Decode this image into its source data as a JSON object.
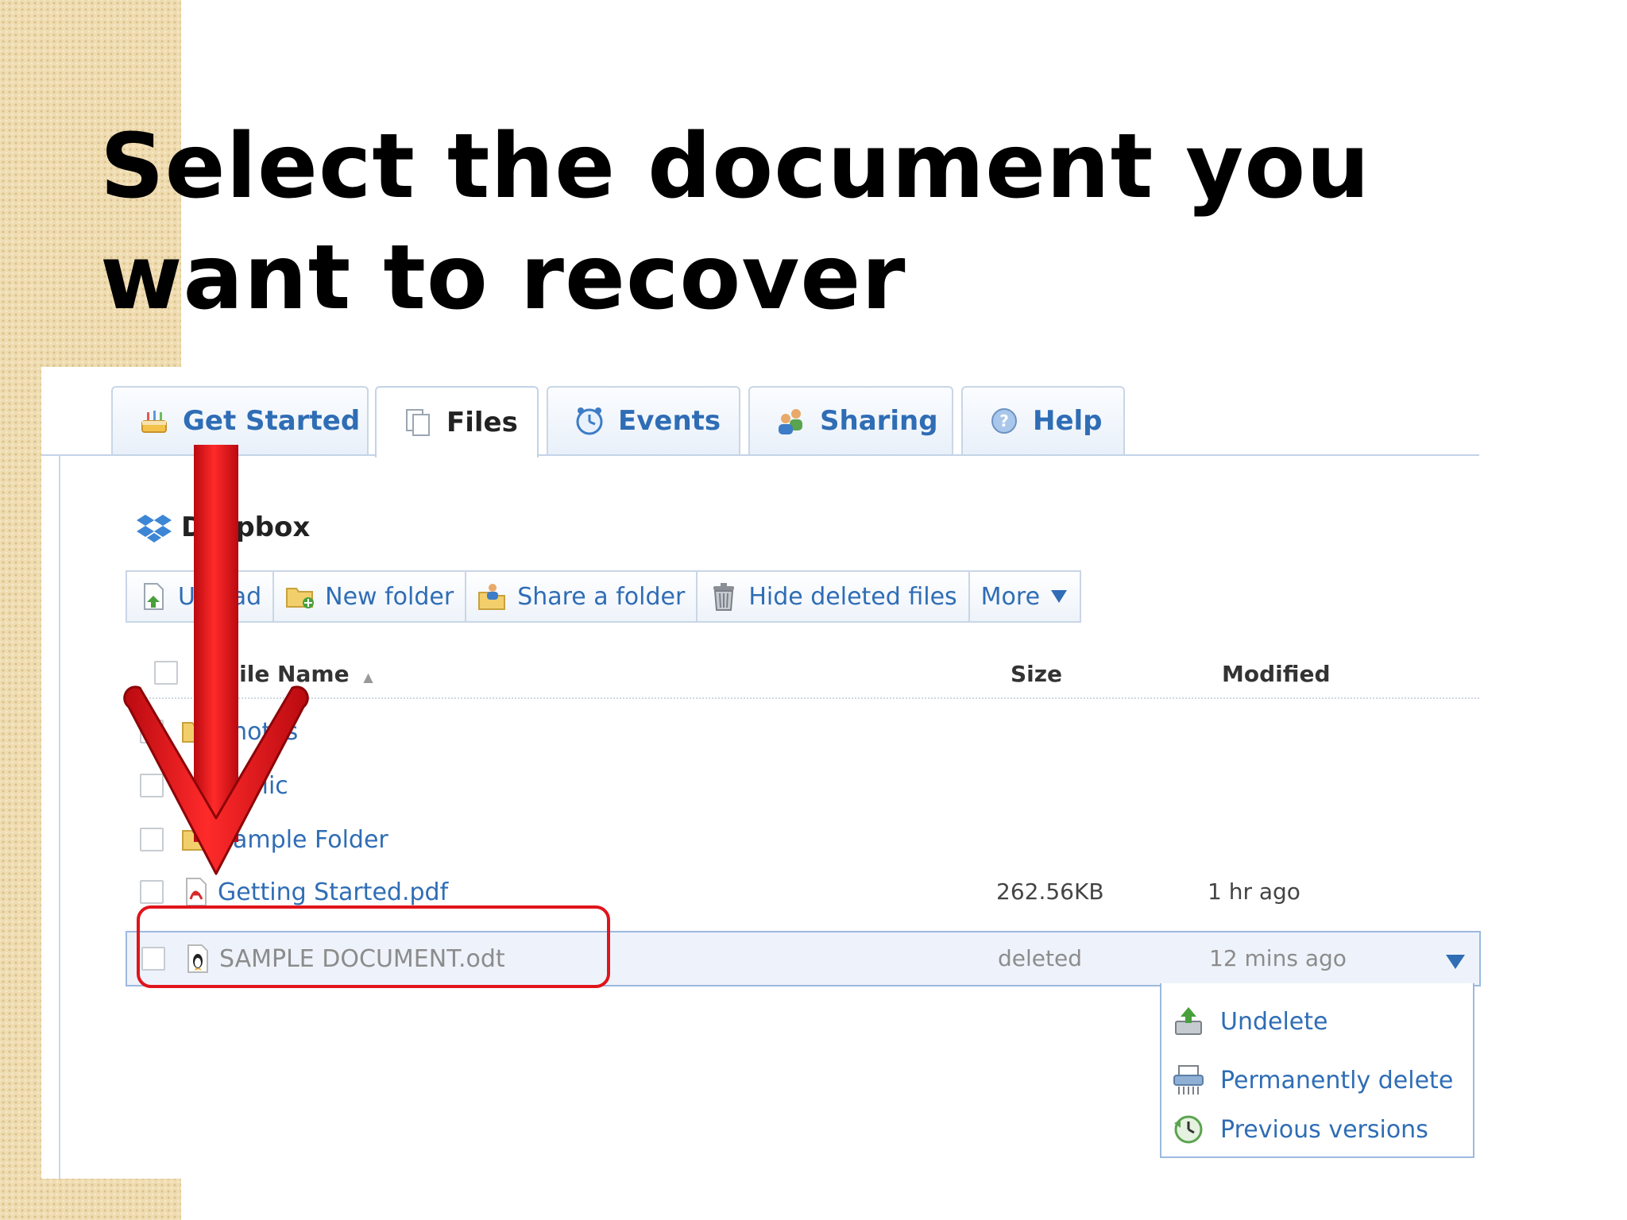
{
  "slide": {
    "title": "Select the document you want to recover"
  },
  "tabs": [
    {
      "label": "Get Started",
      "icon": "cake-icon",
      "active": false
    },
    {
      "label": "Files",
      "icon": "files-icon",
      "active": true
    },
    {
      "label": "Events",
      "icon": "clock-icon",
      "active": false
    },
    {
      "label": "Sharing",
      "icon": "people-icon",
      "active": false
    },
    {
      "label": "Help",
      "icon": "help-icon",
      "active": false
    }
  ],
  "folder_header": {
    "title": "Dropbox",
    "icon": "dropbox-icon"
  },
  "toolbar": {
    "upload": "Upload",
    "new_folder": "New folder",
    "share_folder": "Share a folder",
    "hide_deleted": "Hide deleted files",
    "more": "More"
  },
  "columns": {
    "name": "File Name",
    "name_sort": "▲",
    "size": "Size",
    "modified": "Modified"
  },
  "files": [
    {
      "name": "Photos",
      "size": "",
      "modified": "",
      "type": "folder",
      "icon": "photo-folder-icon"
    },
    {
      "name": "Public",
      "size": "",
      "modified": "",
      "type": "folder",
      "icon": "public-folder-icon"
    },
    {
      "name": "Sample Folder",
      "size": "",
      "modified": "",
      "type": "folder",
      "icon": "folder-icon"
    },
    {
      "name": "Getting Started.pdf",
      "size": "262.56KB",
      "modified": "1 hr ago",
      "type": "pdf",
      "icon": "pdf-icon"
    },
    {
      "name": "SAMPLE DOCUMENT.odt",
      "size": "deleted",
      "modified": "12 mins ago",
      "type": "deleted",
      "icon": "penguin-document-icon"
    }
  ],
  "row_menu": {
    "undelete": "Undelete",
    "permanently_delete": "Permanently delete",
    "previous_versions": "Previous versions"
  },
  "colors": {
    "link_blue": "#2f6db5",
    "annotation_red": "#e0141c",
    "slide_strip": "#efdcb0"
  }
}
